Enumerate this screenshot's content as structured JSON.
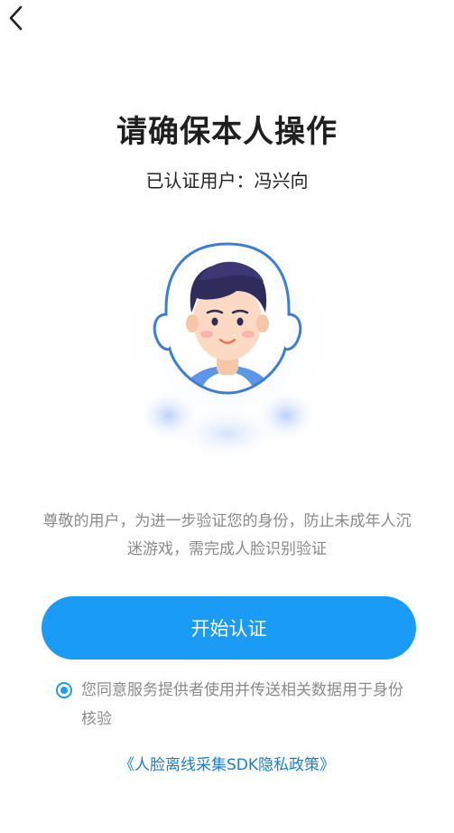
{
  "nav": {
    "back_icon": "chevron-left-icon"
  },
  "header": {
    "title": "请确保本人操作",
    "user_line": "已认证用户：冯兴向"
  },
  "illustration": {
    "icon": "face-portrait-icon",
    "accent": "#3b7dd8"
  },
  "description": "尊敬的用户，为进一步验证您的身份，防止未成年人沉迷游戏，需完成人脸识别验证",
  "action": {
    "start_label": "开始认证",
    "color": "#1a9bf5"
  },
  "consent": {
    "checked": true,
    "text": "您同意服务提供者使用并传送相关数据用于身份核验"
  },
  "policy_link": "《人脸离线采集SDK隐私政策》"
}
